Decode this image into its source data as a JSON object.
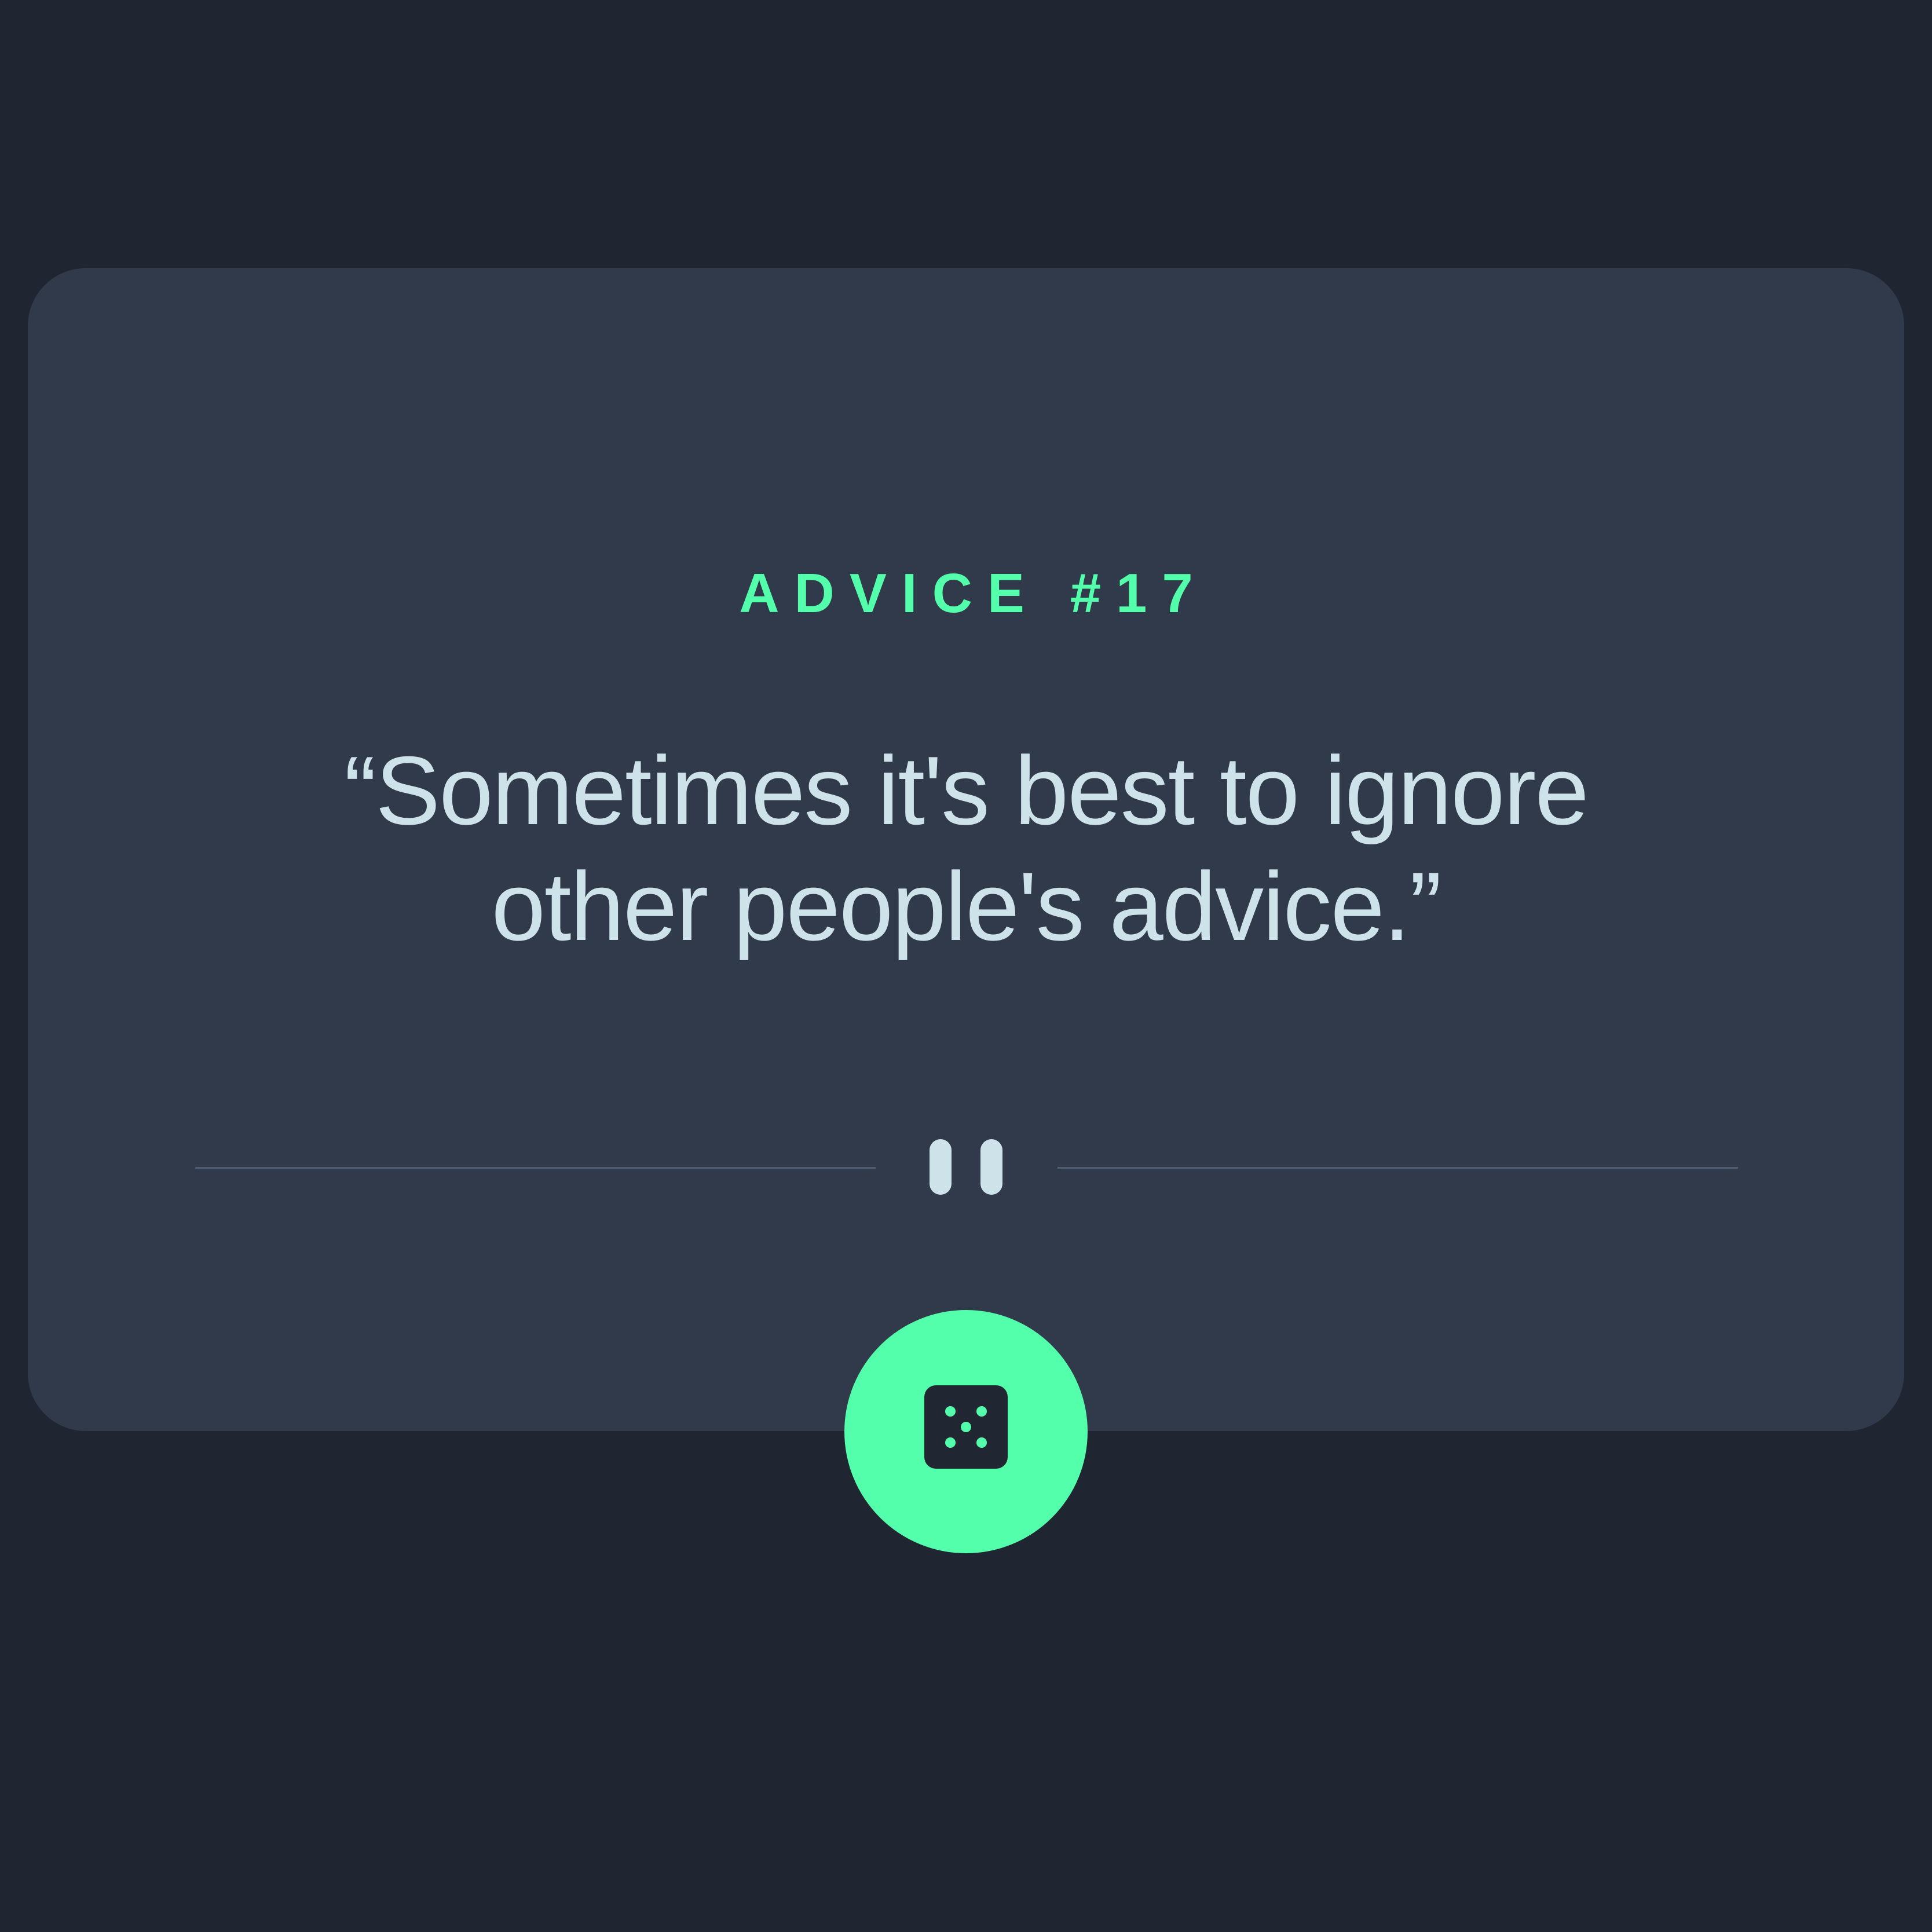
{
  "advice": {
    "label": "ADVICE #17",
    "text": "“Sometimes it's best to ignore other people's advice.”"
  },
  "icons": {
    "divider": "pause-icon",
    "generate": "dice-icon"
  },
  "colors": {
    "background": "#1f2531",
    "card": "#313a4a",
    "accent": "#53ffab",
    "text": "#cee3e9",
    "divider": "#4f5d74"
  }
}
